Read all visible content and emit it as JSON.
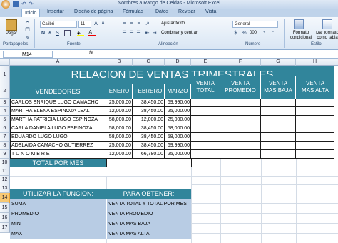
{
  "window": {
    "title": "Nombres a Rango de Celdas - Microsoft Excel"
  },
  "tabs": [
    "Inicio",
    "Insertar",
    "Diseño de página",
    "Fórmulas",
    "Datos",
    "Revisar",
    "Vista"
  ],
  "ribbon": {
    "paste": "Pegar",
    "font_name": "Calibri",
    "font_size": "11",
    "wrap": "Ajustar texto",
    "merge": "Combinar y centrar",
    "number_format": "General",
    "cond_format": "Formato condicional",
    "table_format": "Dar formato como tabla",
    "groups": [
      "Portapapeles",
      "Fuente",
      "Alineación",
      "Número",
      "Estilo"
    ],
    "bold": "N",
    "italic": "K",
    "underline": "S",
    "percent": "%",
    "thousands": "000"
  },
  "formula_bar": {
    "name_box": "M14",
    "fx": "fx",
    "value": ""
  },
  "columns": [
    "A",
    "B",
    "C",
    "D",
    "E",
    "F",
    "G",
    "H"
  ],
  "rows": [
    "1",
    "2",
    "3",
    "4",
    "5",
    "6",
    "7",
    "8",
    "9",
    "10",
    "11",
    "12",
    "13",
    "14",
    "15",
    "16",
    "17"
  ],
  "sheet": {
    "title": "RELACION DE VENTAS TRIMESTRALES",
    "headers": {
      "vendedores": "VENDEDORES",
      "enero": "ENERO",
      "febrero": "FEBRERO",
      "marzo": "MARZO",
      "venta_total": [
        "VENTA",
        "TOTAL"
      ],
      "venta_promedio": [
        "VENTA",
        "PROMEDIO"
      ],
      "venta_baja": [
        "VENTA",
        "MAS BAJA"
      ],
      "venta_alta": [
        "VENTA",
        "MAS ALTA"
      ]
    },
    "data": [
      {
        "name": "CARLOS ENRIQUE LUGO CAMACHO",
        "ene": "25,000.00",
        "feb": "38,450.00",
        "mar": "69,990.00"
      },
      {
        "name": "MARTHA ELENA ESPINOZA LEAL",
        "ene": "12,000.00",
        "feb": "38,450.00",
        "mar": "25,000.00"
      },
      {
        "name": "MARTHA PATRICIA LUGO ESPINOZA",
        "ene": "58,000.00",
        "feb": "12,000.00",
        "mar": "25,000.00"
      },
      {
        "name": "CARLA DANIELA LUGO ESPINOZA",
        "ene": "58,000.00",
        "feb": "38,450.00",
        "mar": "58,000.00"
      },
      {
        "name": "EDUARDO LUGO LUGO",
        "ene": "58,000.00",
        "feb": "38,450.00",
        "mar": "58,000.00"
      },
      {
        "name": "ADELAIDA CAMACHO GUTIERREZ",
        "ene": "25,000.00",
        "feb": "38,450.00",
        "mar": "69,990.00"
      },
      {
        "name": "T U  N O M B R E",
        "ene": "12,000.00",
        "feb": "66,780.00",
        "mar": "25,000.00"
      }
    ],
    "total_label": "TOTAL POR MES",
    "util_label": "UTILIZAR LA FUNCION:",
    "para_label": "PARA OBTENER:",
    "funcs": [
      {
        "f": "SUMA",
        "d": "VENTA TOTAL Y TOTAL POR MES"
      },
      {
        "f": "PROMEDIO",
        "d": "VENTA PROMEDIO"
      },
      {
        "f": "MIN",
        "d": "VENTA MAS BAJA"
      },
      {
        "f": "MAX",
        "d": "VENTA MAS ALTA"
      }
    ]
  },
  "colors": {
    "teal": "#31859b",
    "light_blue": "#b8cce4"
  }
}
